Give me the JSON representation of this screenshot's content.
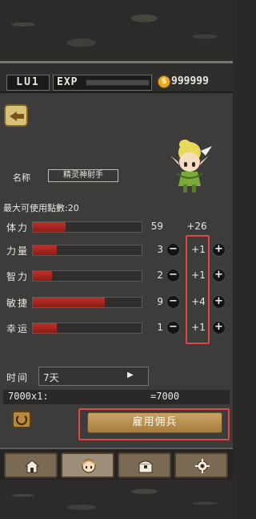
{
  "hud": {
    "level": "LU1",
    "exp_label": "EXP",
    "exp_progress": 0.0,
    "coin_symbol": "$",
    "gold": "999999"
  },
  "character": {
    "name_label": "名称",
    "name": "精灵神射手"
  },
  "points_label": "最大可使用點數:20",
  "stats": [
    {
      "name": "体力",
      "value": "59",
      "fill": 0.3,
      "plus": "+26"
    },
    {
      "name": "力量",
      "value": "3",
      "fill": 0.22,
      "plus": "+1"
    },
    {
      "name": "智力",
      "value": "2",
      "fill": 0.18,
      "plus": "+1"
    },
    {
      "name": "敏捷",
      "value": "9",
      "fill": 0.66,
      "plus": "+4"
    },
    {
      "name": "幸运",
      "value": "1",
      "fill": 0.22,
      "plus": "+1"
    }
  ],
  "controls": {
    "minus": "−",
    "plus": "+"
  },
  "time": {
    "label": "时间",
    "value": "7天",
    "arrow": "▶"
  },
  "calc": {
    "formula": "7000x1:",
    "result": "=7000"
  },
  "hire_label": "雇用佣兵",
  "tabs": [
    "home",
    "mercenary",
    "inventory",
    "settings"
  ],
  "colors": {
    "stat_bar": "#c03028",
    "highlight": "#e0474a",
    "hire_button": "#c9a468"
  }
}
